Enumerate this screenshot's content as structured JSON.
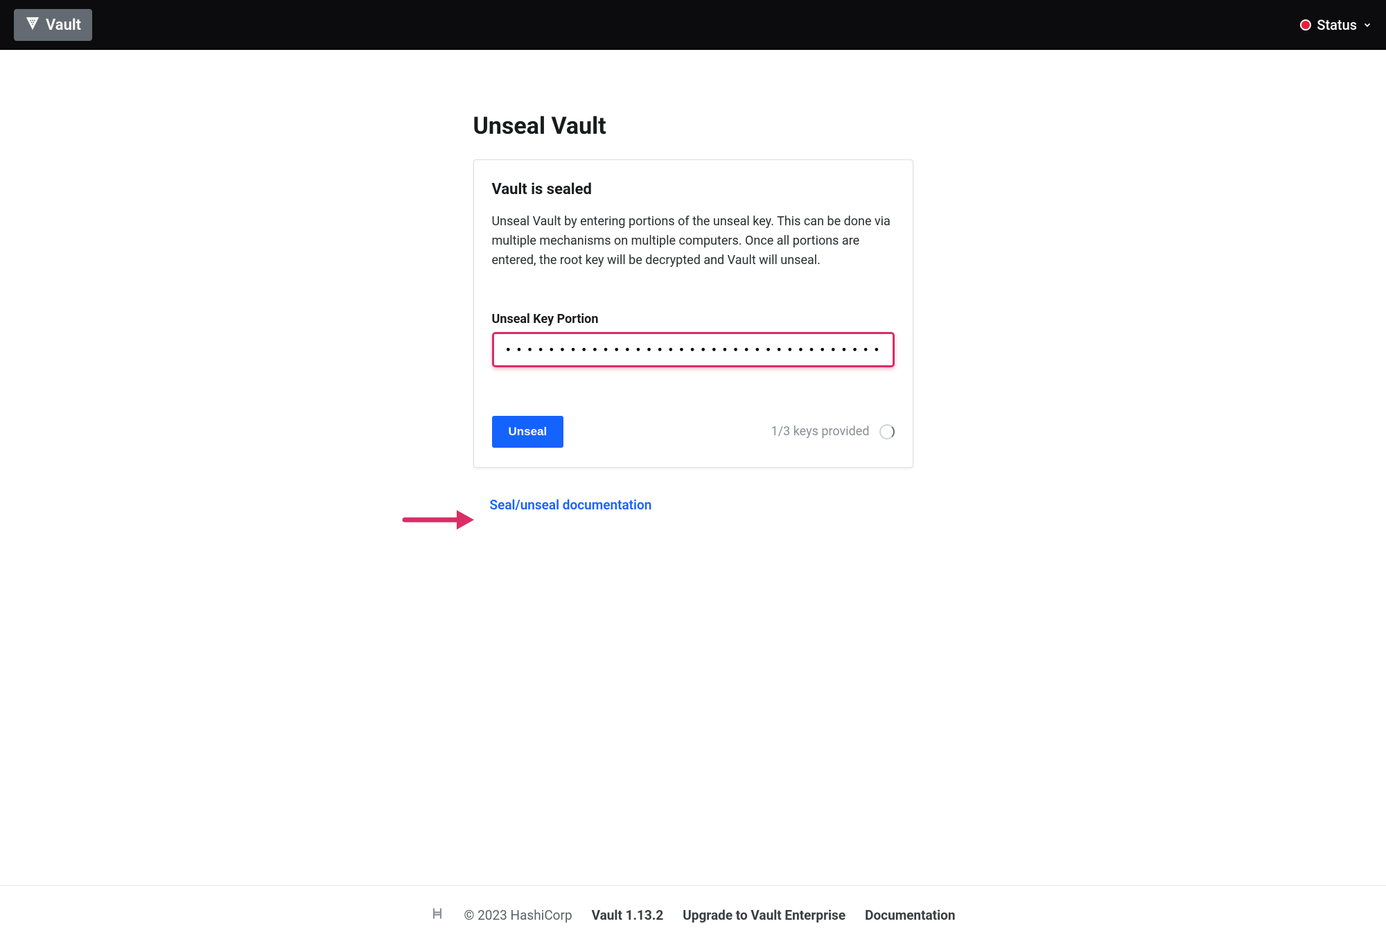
{
  "header": {
    "logo_text": "Vault",
    "status_label": "Status"
  },
  "main": {
    "page_title": "Unseal Vault",
    "card": {
      "title": "Vault is sealed",
      "description": "Unseal Vault by entering portions of the unseal key. This can be done via multiple mechanisms on multiple computers. Once all portions are entered, the root key will be decrypted and Vault will unseal.",
      "input_label": "Unseal Key Portion",
      "input_value": "••••••••••••••••••••••••••••••••••••••••••••••••••••••••••••••••••",
      "unseal_button": "Unseal",
      "keys_status": "1/3 keys provided"
    },
    "doc_link": "Seal/unseal documentation"
  },
  "footer": {
    "copyright": "© 2023 HashiCorp",
    "version": "Vault 1.13.2",
    "upgrade_link": "Upgrade to Vault Enterprise",
    "docs_link": "Documentation"
  },
  "colors": {
    "primary_blue": "#1563ff",
    "highlight_pink": "#d92d66",
    "status_red": "#e5203a",
    "header_bg": "#0c0c0e"
  }
}
